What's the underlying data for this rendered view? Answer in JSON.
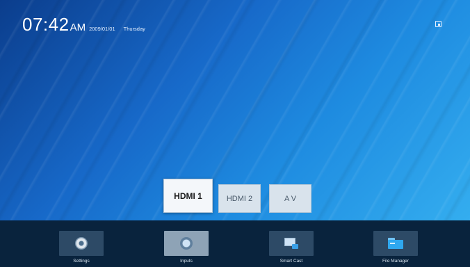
{
  "clock": {
    "time": "07:42",
    "ampm": "AM",
    "date": "2009/01/01",
    "weekday": "Thursday"
  },
  "top_right_icon": "notification-icon",
  "input_sources": [
    {
      "label": "HDMI 1",
      "active": true
    },
    {
      "label": "HDMI 2",
      "active": false
    },
    {
      "label": "A V",
      "active": false
    }
  ],
  "apps": [
    {
      "label": "Settings",
      "icon": "settings-icon",
      "selected": false
    },
    {
      "label": "Inputs",
      "icon": "inputs-icon",
      "selected": true
    },
    {
      "label": "Smart Cast",
      "icon": "smart-cast-icon",
      "selected": false
    },
    {
      "label": "File Manager",
      "icon": "folder-icon",
      "selected": false
    }
  ],
  "colors": {
    "background_top": "#0b3d8c",
    "background_bottom": "#38b4f2",
    "bottom_bar": "#09233d"
  }
}
